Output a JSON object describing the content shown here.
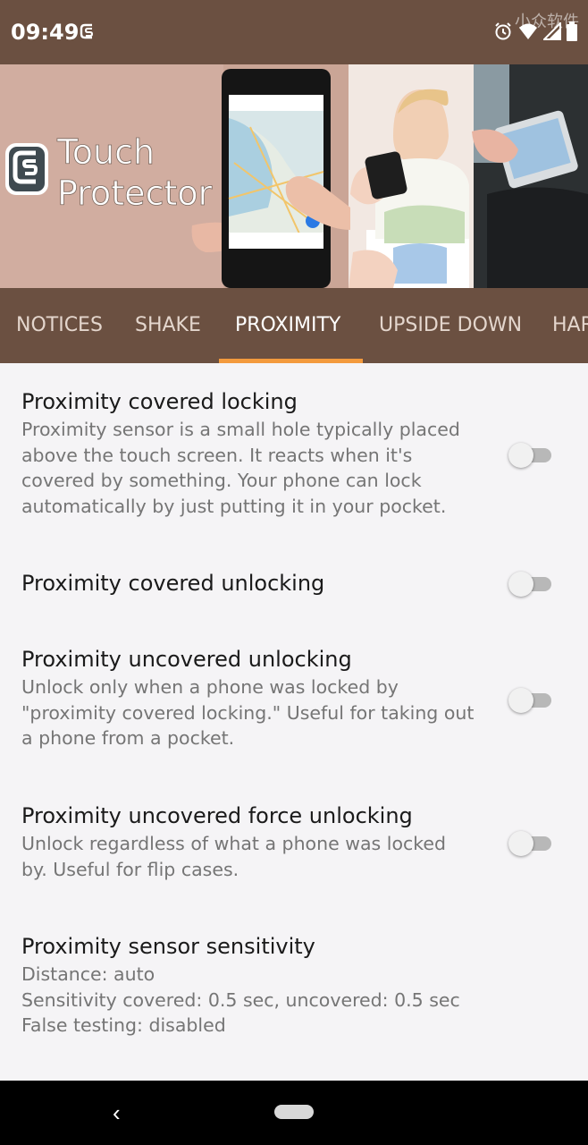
{
  "status_bar": {
    "time": "09:49",
    "watermark": "小众软件",
    "icons": [
      "app-notification-icon",
      "alarm-icon",
      "wifi-icon",
      "signal-icon",
      "battery-icon"
    ]
  },
  "banner": {
    "logo_line1": "Touch",
    "logo_line2": "Protector"
  },
  "tabs": [
    {
      "label": "NOTICES",
      "active": false
    },
    {
      "label": "SHAKE",
      "active": false
    },
    {
      "label": "PROXIMITY",
      "active": true
    },
    {
      "label": "UPSIDE DOWN",
      "active": false
    },
    {
      "label": "HAR",
      "active": false
    }
  ],
  "settings": [
    {
      "title": "Proximity covered locking",
      "desc": [
        "Proximity sensor is a small hole typically placed",
        "above the touch screen. It reacts when it's",
        "covered by something. Your phone can lock",
        "automatically by just putting it in your pocket."
      ],
      "enabled": false
    },
    {
      "title": "Proximity covered unlocking",
      "enabled": false
    },
    {
      "title": "Proximity uncovered unlocking",
      "desc": [
        "Unlock only when a phone was locked by",
        "\"proximity covered locking.\" Useful for taking out",
        "a phone from a pocket."
      ],
      "enabled": false
    },
    {
      "title": "Proximity uncovered force unlocking",
      "desc": [
        "Unlock regardless of what a phone was locked",
        "by. Useful for flip cases."
      ],
      "enabled": false
    },
    {
      "title": "Proximity sensor sensitivity",
      "desc": [
        "Distance: auto",
        "Sensitivity covered: 0.5 sec, uncovered: 0.5 sec",
        "False testing: disabled"
      ]
    }
  ],
  "colors": {
    "primary": "#6b5041",
    "accent": "#f39a3d",
    "background": "#f5f4f6"
  }
}
